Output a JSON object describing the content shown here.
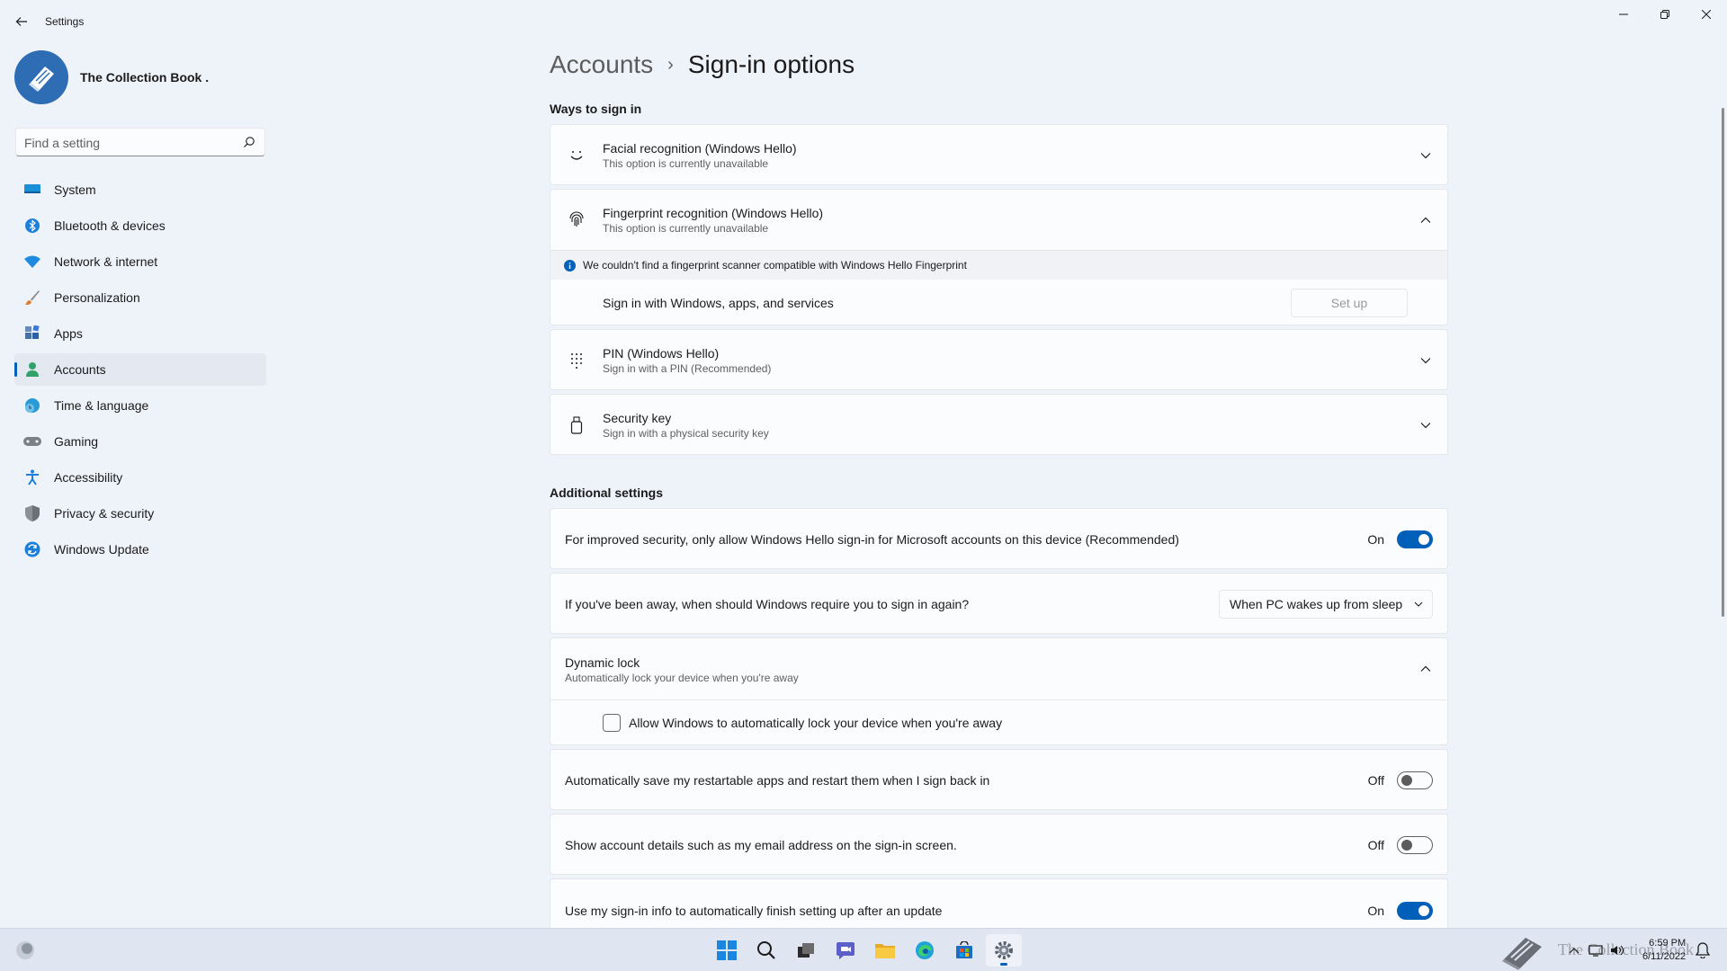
{
  "app": {
    "title": "Settings"
  },
  "profile": {
    "name": "The Collection Book ."
  },
  "search": {
    "placeholder": "Find a setting"
  },
  "sidebar": {
    "items": [
      {
        "label": "System",
        "icon": "monitor-icon"
      },
      {
        "label": "Bluetooth & devices",
        "icon": "bluetooth-icon"
      },
      {
        "label": "Network & internet",
        "icon": "wifi-icon"
      },
      {
        "label": "Personalization",
        "icon": "brush-icon"
      },
      {
        "label": "Apps",
        "icon": "apps-icon"
      },
      {
        "label": "Accounts",
        "icon": "person-icon",
        "active": true
      },
      {
        "label": "Time & language",
        "icon": "globe-clock-icon"
      },
      {
        "label": "Gaming",
        "icon": "gamepad-icon"
      },
      {
        "label": "Accessibility",
        "icon": "accessibility-icon"
      },
      {
        "label": "Privacy & security",
        "icon": "shield-icon"
      },
      {
        "label": "Windows Update",
        "icon": "update-icon"
      }
    ]
  },
  "breadcrumb": {
    "parent": "Accounts",
    "separator": "›",
    "current": "Sign-in options"
  },
  "ways": {
    "title": "Ways to sign in",
    "facial": {
      "title": "Facial recognition (Windows Hello)",
      "sub": "This option is currently unavailable"
    },
    "fingerprint": {
      "title": "Fingerprint recognition (Windows Hello)",
      "sub": "This option is currently unavailable",
      "info": "We couldn't find a fingerprint scanner compatible with Windows Hello Fingerprint",
      "signin_label": "Sign in with Windows, apps, and services",
      "setup_label": "Set up"
    },
    "pin": {
      "title": "PIN (Windows Hello)",
      "sub": "Sign in with a PIN (Recommended)"
    },
    "security_key": {
      "title": "Security key",
      "sub": "Sign in with a physical security key"
    }
  },
  "additional": {
    "title": "Additional settings",
    "hello_only": {
      "label": "For improved security, only allow Windows Hello sign-in for Microsoft accounts on this device (Recommended)",
      "state": "On",
      "on": true
    },
    "require_signin": {
      "label": "If you've been away, when should Windows require you to sign in again?",
      "value": "When PC wakes up from sleep"
    },
    "dynamic_lock": {
      "title": "Dynamic lock",
      "sub": "Automatically lock your device when you're away",
      "checkbox_label": "Allow Windows to automatically lock your device when you're away",
      "checked": false
    },
    "restart_apps": {
      "label": "Automatically save my restartable apps and restart them when I sign back in",
      "state": "Off",
      "on": false
    },
    "account_details": {
      "label": "Show account details such as my email address on the sign-in screen.",
      "state": "Off",
      "on": false
    },
    "finish_setup": {
      "label": "Use my sign-in info to automatically finish setting up after an update",
      "state": "On",
      "on": true
    }
  },
  "taskbar": {
    "watermark": "The Collection Book",
    "time": "6:59 PM",
    "date": "6/11/2022"
  },
  "colors": {
    "accent": "#005fb8",
    "background": "#eef2f9",
    "card": "#fbfcfe"
  }
}
